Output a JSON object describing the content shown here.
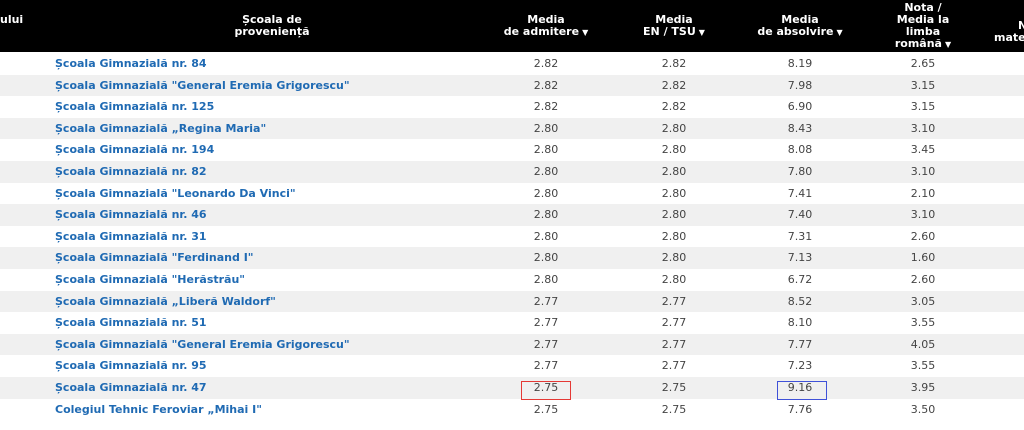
{
  "header": {
    "partial_left": "ului",
    "school_col": [
      "Școala de",
      "proveniență"
    ],
    "admission_col": [
      "Media",
      "de admitere"
    ],
    "en_col": [
      "Media",
      "EN / TSU"
    ],
    "graduation_col": [
      "Media",
      "de absolvire"
    ],
    "romanian_col": [
      "Nota /",
      "Media la",
      "limba",
      "română"
    ],
    "partial_right": [
      "N",
      "mate"
    ],
    "sort_icon": "▼"
  },
  "rows": [
    {
      "school": "Școala Gimnazială nr. 84",
      "admission": "2.82",
      "en": "2.82",
      "graduation": "8.19",
      "romanian": "2.65"
    },
    {
      "school": "Școala Gimnazială \"General Eremia Grigorescu\"",
      "admission": "2.82",
      "en": "2.82",
      "graduation": "7.98",
      "romanian": "3.15"
    },
    {
      "school": "Școala Gimnazială nr. 125",
      "admission": "2.82",
      "en": "2.82",
      "graduation": "6.90",
      "romanian": "3.15"
    },
    {
      "school": "Școala Gimnazială „Regina Maria\"",
      "admission": "2.80",
      "en": "2.80",
      "graduation": "8.43",
      "romanian": "3.10"
    },
    {
      "school": "Școala Gimnazială nr. 194",
      "admission": "2.80",
      "en": "2.80",
      "graduation": "8.08",
      "romanian": "3.45"
    },
    {
      "school": "Școala Gimnazială nr. 82",
      "admission": "2.80",
      "en": "2.80",
      "graduation": "7.80",
      "romanian": "3.10"
    },
    {
      "school": "Școala Gimnazială \"Leonardo Da Vinci\"",
      "admission": "2.80",
      "en": "2.80",
      "graduation": "7.41",
      "romanian": "2.10"
    },
    {
      "school": "Școala Gimnazială nr. 46",
      "admission": "2.80",
      "en": "2.80",
      "graduation": "7.40",
      "romanian": "3.10"
    },
    {
      "school": "Școala Gimnazială nr. 31",
      "admission": "2.80",
      "en": "2.80",
      "graduation": "7.31",
      "romanian": "2.60"
    },
    {
      "school": "Școala Gimnazială \"Ferdinand I\"",
      "admission": "2.80",
      "en": "2.80",
      "graduation": "7.13",
      "romanian": "1.60"
    },
    {
      "school": "Școala Gimnazială \"Herăstrău\"",
      "admission": "2.80",
      "en": "2.80",
      "graduation": "6.72",
      "romanian": "2.60"
    },
    {
      "school": "Școala Gimnazială „Liberă Waldorf\"",
      "admission": "2.77",
      "en": "2.77",
      "graduation": "8.52",
      "romanian": "3.05"
    },
    {
      "school": "Școala Gimnazială nr. 51",
      "admission": "2.77",
      "en": "2.77",
      "graduation": "8.10",
      "romanian": "3.55"
    },
    {
      "school": "Școala Gimnazială \"General Eremia Grigorescu\"",
      "admission": "2.77",
      "en": "2.77",
      "graduation": "7.77",
      "romanian": "4.05"
    },
    {
      "school": "Școala Gimnazială nr. 95",
      "admission": "2.77",
      "en": "2.77",
      "graduation": "7.23",
      "romanian": "3.55"
    },
    {
      "school": "Școala Gimnazială nr. 47",
      "admission": "2.75",
      "en": "2.75",
      "graduation": "9.16",
      "romanian": "3.95"
    },
    {
      "school": "Colegiul Tehnic Feroviar „Mihai I\"",
      "admission": "2.75",
      "en": "2.75",
      "graduation": "7.76",
      "romanian": "3.50"
    }
  ],
  "highlights": {
    "admission_box_color": "#e53935",
    "graduation_box_color": "#3f51d8"
  },
  "colors": {
    "header_bg": "#000000",
    "row_alt_bg": "#f0f0f0",
    "link": "#1f6ab3"
  }
}
